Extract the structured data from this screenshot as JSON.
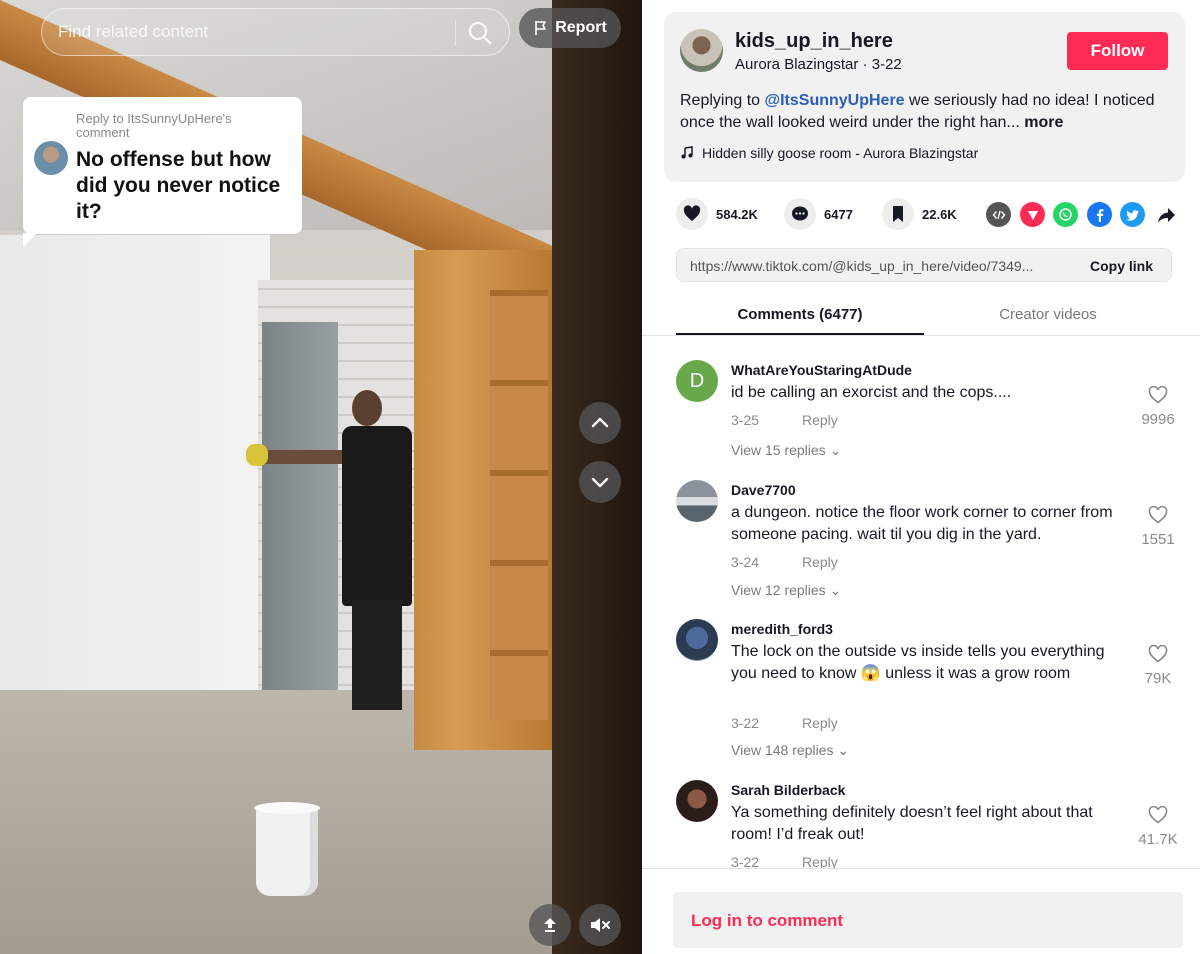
{
  "search": {
    "placeholder": "Find related content"
  },
  "report": {
    "label": "Report"
  },
  "reply_bubble": {
    "meta": "Reply to ItsSunnyUpHere's comment",
    "text": "No offense but how did you never notice it?"
  },
  "author": {
    "handle": "kids_up_in_here",
    "display_name": "Aurora Blazingstar",
    "date": "3-22",
    "sub": "Aurora Blazingstar · 3-22",
    "follow_label": "Follow"
  },
  "caption": {
    "prefix": "Replying to ",
    "mention": "@ItsSunnyUpHere",
    "text": " we seriously had no idea! I noticed once the wall looked weird under the right han...",
    "more": "more"
  },
  "music": {
    "title": "Hidden silly goose room - Aurora Blazingstar"
  },
  "stats": {
    "likes": "584.2K",
    "comments": "6477",
    "saves": "22.6K"
  },
  "share_icons": [
    "embed-icon",
    "send-icon",
    "whatsapp-icon",
    "facebook-icon",
    "twitter-icon",
    "share-arrow-icon"
  ],
  "link": {
    "url": "https://www.tiktok.com/@kids_up_in_here/video/7349...",
    "copy_label": "Copy link"
  },
  "tabs": {
    "comments": "Comments (6477)",
    "creator": "Creator videos"
  },
  "comments": [
    {
      "user": "WhatAreYouStaringAtDude",
      "text": "id be calling an exorcist and the cops....",
      "date": "3-25",
      "reply": "Reply",
      "view": "View 15 replies",
      "likes": "9996",
      "avatar_letter": "D"
    },
    {
      "user": "Dave7700",
      "text": "a dungeon. notice the floor work corner to corner from someone pacing. wait til you dig in the yard.",
      "date": "3-24",
      "reply": "Reply",
      "view": "View 12 replies",
      "likes": "1551"
    },
    {
      "user": "meredith_ford3",
      "text": "The lock on the outside vs inside tells you everything you need to know 😱 unless it was a grow room",
      "date": "3-22",
      "reply": "Reply",
      "view": "View 148 replies",
      "likes": "79K"
    },
    {
      "user": "Sarah Bilderback",
      "text": "Ya something definitely doesn’t feel right about that room! I’d freak out!",
      "date": "3-22",
      "reply": "Reply",
      "likes": "41.7K"
    }
  ],
  "login": {
    "label": "Log in to comment"
  },
  "colors": {
    "accent": "#fe2c55",
    "mention": "#2b5db9",
    "text": "#161823",
    "muted": "#8a8a8a"
  }
}
